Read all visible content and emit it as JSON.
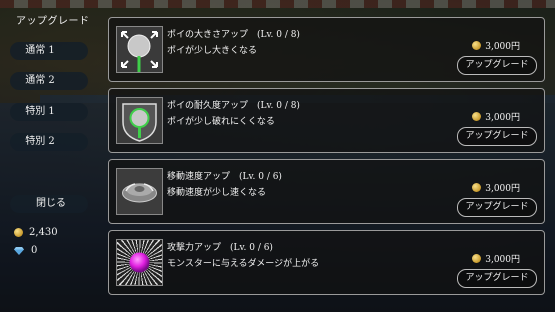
{
  "panel": {
    "title": "アップグレード"
  },
  "sidebar": {
    "tabs": [
      {
        "label": "通常 1"
      },
      {
        "label": "通常 2"
      },
      {
        "label": "特別 1"
      },
      {
        "label": "特別 2"
      }
    ],
    "close_label": "閉じる",
    "coins": "2,430",
    "gems": "0"
  },
  "upgrades": [
    {
      "title": "ポイの大きさアップ　(Lv. 0 / 8)",
      "description": "ポイが少し大きくなる",
      "price": "3,000円",
      "button_label": "アップグレード",
      "icon": "expand-poi-icon"
    },
    {
      "title": "ポイの耐久度アップ　(Lv. 0 / 8)",
      "description": "ポイが少し破れにくくなる",
      "price": "3,000円",
      "button_label": "アップグレード",
      "icon": "shield-poi-icon"
    },
    {
      "title": "移動速度アップ　(Lv. 0 / 6)",
      "description": "移動速度が少し速くなる",
      "price": "3,000円",
      "button_label": "アップグレード",
      "icon": "speed-disc-icon"
    },
    {
      "title": "攻撃力アップ　(Lv. 0 / 6)",
      "description": "モンスターに与えるダメージが上がる",
      "price": "3,000円",
      "button_label": "アップグレード",
      "icon": "attack-orb-icon"
    }
  ],
  "colors": {
    "coin": "#d4a53a",
    "gem": "#5aa8e0",
    "poi_handle": "#3fcf4a",
    "attack_orb": "#e020e0"
  }
}
